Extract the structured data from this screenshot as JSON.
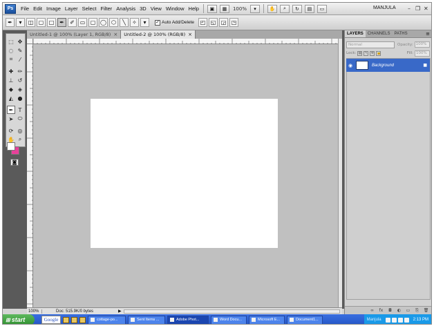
{
  "app": {
    "logo": "Ps",
    "workspace": "MANJULA"
  },
  "menu": [
    "File",
    "Edit",
    "Image",
    "Layer",
    "Select",
    "Filter",
    "Analysis",
    "3D",
    "View",
    "Window",
    "Help"
  ],
  "menubar": {
    "zoom": "100%"
  },
  "options": {
    "auto_add_delete": "Auto Add/Delete"
  },
  "tabs": [
    {
      "label": "Untitled-1 @ 100% (Layer 1, RGB/8)",
      "close": "×"
    },
    {
      "label": "Untitled-2 @ 100% (RGB/8)",
      "close": "×"
    }
  ],
  "status": {
    "zoom": "100%",
    "doc": "Doc: 515.9K/0 bytes"
  },
  "layers_panel": {
    "tabs": [
      "LAYERS",
      "CHANNELS",
      "PATHS"
    ],
    "blend_mode": "Normal",
    "opacity_label": "Opacity:",
    "opacity": "100%",
    "lock_label": "Lock:",
    "fill_label": "Fill:",
    "fill": "100%",
    "layer_name": "Background"
  },
  "colors": {
    "foreground": "#ffffff",
    "background": "#e8409a",
    "selected_layer": "#3969c8"
  },
  "taskbar": {
    "start": "start",
    "google": "Google",
    "tasks": [
      "cottage-po...",
      "Sent Items ...",
      "Adobe Phot...",
      "Word Docu...",
      "Microsoft E...",
      "Document1..."
    ],
    "tray_user": "Manjula",
    "clock": "2:13 PM"
  }
}
